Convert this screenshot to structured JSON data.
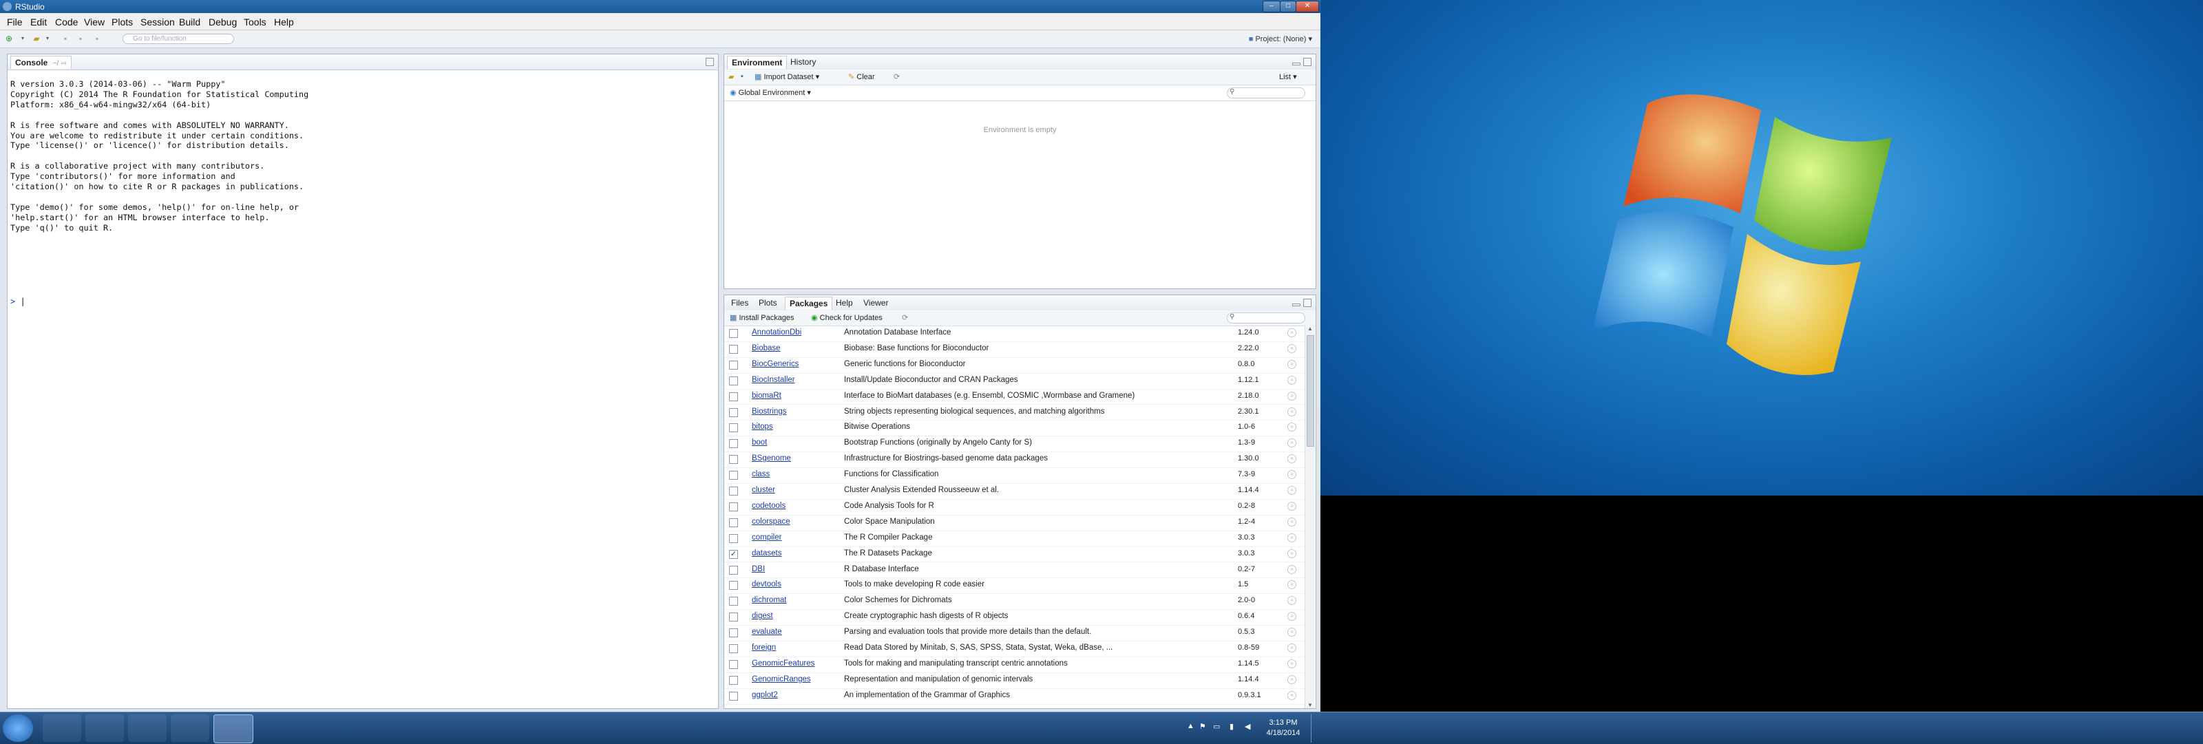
{
  "window": {
    "title": "RStudio",
    "controls": [
      "–",
      "□",
      "✕"
    ]
  },
  "menu": [
    "File",
    "Edit",
    "Code",
    "View",
    "Plots",
    "Session",
    "Build",
    "Debug",
    "Tools",
    "Help"
  ],
  "toolbar": {
    "goto_placeholder": "Go to file/function",
    "project": "Project: (None)"
  },
  "console": {
    "tab": "Console",
    "path": "~/",
    "text": "R version 3.0.3 (2014-03-06) -- \"Warm Puppy\"\nCopyright (C) 2014 The R Foundation for Statistical Computing\nPlatform: x86_64-w64-mingw32/x64 (64-bit)\n\nR is free software and comes with ABSOLUTELY NO WARRANTY.\nYou are welcome to redistribute it under certain conditions.\nType 'license()' or 'licence()' for distribution details.\n\nR is a collaborative project with many contributors.\nType 'contributors()' for more information and\n'citation()' on how to cite R or R packages in publications.\n\nType 'demo()' for some demos, 'help()' for on-line help, or\n'help.start()' for an HTML browser interface to help.\nType 'q()' to quit R.",
    "prompt": ">"
  },
  "env": {
    "tabs": [
      "Environment",
      "History"
    ],
    "import": "Import Dataset",
    "clear": "Clear",
    "list_mode": "List",
    "scope": "Global Environment",
    "empty": "Environment is empty"
  },
  "pkg": {
    "tabs": [
      "Files",
      "Plots",
      "Packages",
      "Help",
      "Viewer"
    ],
    "install": "Install Packages",
    "update": "Check for Updates",
    "rows": [
      {
        "name": "AnnotationDbi",
        "desc": "Annotation Database Interface",
        "ver": "1.24.0",
        "checked": false
      },
      {
        "name": "Biobase",
        "desc": "Biobase: Base functions for Bioconductor",
        "ver": "2.22.0",
        "checked": false
      },
      {
        "name": "BiocGenerics",
        "desc": "Generic functions for Bioconductor",
        "ver": "0.8.0",
        "checked": false
      },
      {
        "name": "BiocInstaller",
        "desc": "Install/Update Bioconductor and CRAN Packages",
        "ver": "1.12.1",
        "checked": false
      },
      {
        "name": "biomaRt",
        "desc": "Interface to BioMart databases (e.g. Ensembl, COSMIC ,Wormbase and Gramene)",
        "ver": "2.18.0",
        "checked": false
      },
      {
        "name": "Biostrings",
        "desc": "String objects representing biological sequences, and matching algorithms",
        "ver": "2.30.1",
        "checked": false
      },
      {
        "name": "bitops",
        "desc": "Bitwise Operations",
        "ver": "1.0-6",
        "checked": false
      },
      {
        "name": "boot",
        "desc": "Bootstrap Functions (originally by Angelo Canty for S)",
        "ver": "1.3-9",
        "checked": false
      },
      {
        "name": "BSgenome",
        "desc": "Infrastructure for Biostrings-based genome data packages",
        "ver": "1.30.0",
        "checked": false
      },
      {
        "name": "class",
        "desc": "Functions for Classification",
        "ver": "7.3-9",
        "checked": false
      },
      {
        "name": "cluster",
        "desc": "Cluster Analysis Extended Rousseeuw et al.",
        "ver": "1.14.4",
        "checked": false
      },
      {
        "name": "codetools",
        "desc": "Code Analysis Tools for R",
        "ver": "0.2-8",
        "checked": false
      },
      {
        "name": "colorspace",
        "desc": "Color Space Manipulation",
        "ver": "1.2-4",
        "checked": false
      },
      {
        "name": "compiler",
        "desc": "The R Compiler Package",
        "ver": "3.0.3",
        "checked": false
      },
      {
        "name": "datasets",
        "desc": "The R Datasets Package",
        "ver": "3.0.3",
        "checked": true
      },
      {
        "name": "DBI",
        "desc": "R Database Interface",
        "ver": "0.2-7",
        "checked": false
      },
      {
        "name": "devtools",
        "desc": "Tools to make developing R code easier",
        "ver": "1.5",
        "checked": false
      },
      {
        "name": "dichromat",
        "desc": "Color Schemes for Dichromats",
        "ver": "2.0-0",
        "checked": false
      },
      {
        "name": "digest",
        "desc": "Create cryptographic hash digests of R objects",
        "ver": "0.6.4",
        "checked": false
      },
      {
        "name": "evaluate",
        "desc": "Parsing and evaluation tools that provide more details than the default.",
        "ver": "0.5.3",
        "checked": false
      },
      {
        "name": "foreign",
        "desc": "Read Data Stored by Minitab, S, SAS, SPSS, Stata, Systat, Weka, dBase, ...",
        "ver": "0.8-59",
        "checked": false
      },
      {
        "name": "GenomicFeatures",
        "desc": "Tools for making and manipulating transcript centric annotations",
        "ver": "1.14.5",
        "checked": false
      },
      {
        "name": "GenomicRanges",
        "desc": "Representation and manipulation of genomic intervals",
        "ver": "1.14.4",
        "checked": false
      },
      {
        "name": "ggplot2",
        "desc": "An implementation of the Grammar of Graphics",
        "ver": "0.9.3.1",
        "checked": false
      }
    ]
  },
  "taskbar": {
    "time": "3:13 PM",
    "date": "4/18/2014"
  }
}
